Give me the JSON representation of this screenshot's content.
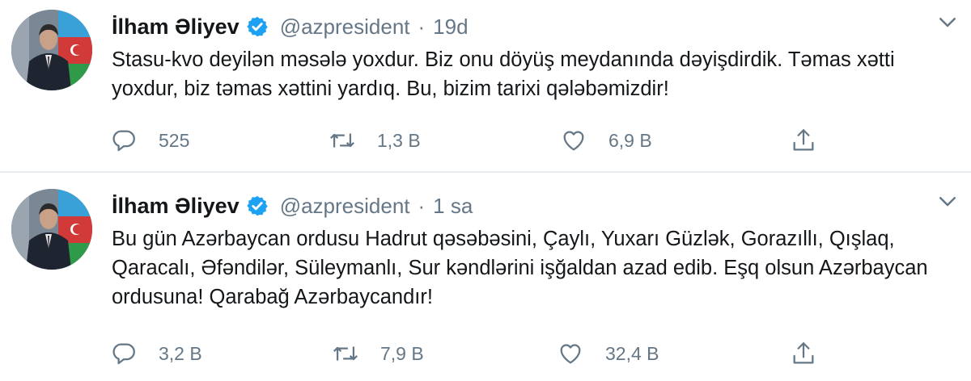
{
  "tweets": [
    {
      "author_name": "İlham Əliyev",
      "handle": "@azpresident",
      "separator": "·",
      "time": "19d",
      "text": "Stasu-kvo deyilən məsələ yoxdur. Biz onu döyüş meydanında dəyişdirdik. Təmas xətti yoxdur, biz təmas xəttini yardıq. Bu, bizim tarixi qələbəmizdir!",
      "reply_count": "525",
      "retweet_count": "1,3 B",
      "like_count": "6,9 B"
    },
    {
      "author_name": "İlham Əliyev",
      "handle": "@azpresident",
      "separator": "·",
      "time": "1 sa",
      "text": "Bu gün Azərbaycan ordusu Hadrut qəsəbəsini, Çaylı, Yuxarı Güzlək, Gorazıllı, Qışlaq, Qaracalı, Əfəndilər, Süleymanlı, Sur kəndlərini işğaldan azad edib. Eşq olsun Azərbaycan ordusuna! Qarabağ Azərbaycandır!",
      "reply_count": "3,2 B",
      "retweet_count": "7,9 B",
      "like_count": "32,4 B"
    }
  ],
  "icons": {
    "verified": "verified-badge-icon",
    "caret": "chevron-down-icon",
    "reply": "reply-bubble-icon",
    "retweet": "retweet-icon",
    "like": "heart-icon",
    "share": "share-upload-icon"
  },
  "colors": {
    "verified": "#1da1f2",
    "icon_gray": "#657786",
    "text": "#14171a",
    "divider": "#e6ecf0"
  }
}
